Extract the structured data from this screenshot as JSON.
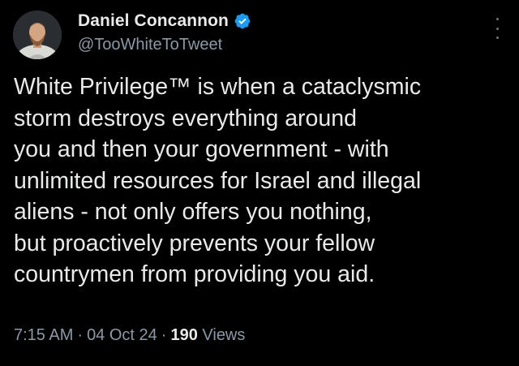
{
  "author": {
    "display_name": "Daniel Concannon",
    "handle": "@TooWhiteToTweet",
    "verified": true,
    "verified_color": "#1d9bf0"
  },
  "menu_icon": "more-vertical-icon",
  "tweet": {
    "lines": [
      "White Privilege™ is when a cataclysmic",
      "storm destroys everything around",
      "you and then your government - with",
      "unlimited resources for Israel and illegal",
      "aliens - not only offers you nothing,",
      "but proactively prevents your fellow",
      "countrymen from providing you aid."
    ]
  },
  "meta": {
    "time": "7:15 AM",
    "separator": "·",
    "date": "04 Oct 24",
    "views_count": "190",
    "views_label": "Views"
  },
  "colors": {
    "background": "#000000",
    "primary_text": "#e7e9ea",
    "secondary_text": "#8b98a5"
  }
}
